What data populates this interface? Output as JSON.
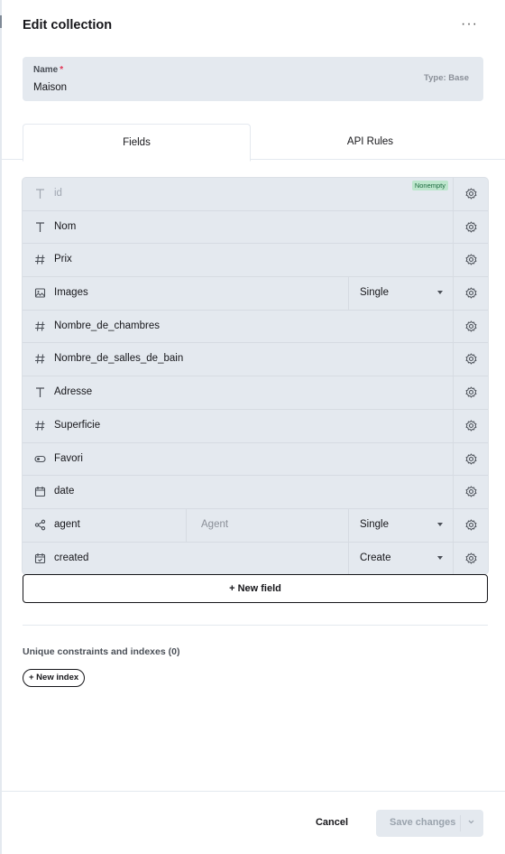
{
  "header": {
    "title": "Edit collection",
    "more": "···"
  },
  "name_field": {
    "label": "Name",
    "required": "*",
    "value": "Maison",
    "type": "Type: Base"
  },
  "tabs": [
    {
      "label": "Fields"
    },
    {
      "label": "API Rules"
    }
  ],
  "fields": [
    {
      "name": "id",
      "icon": "text-icon",
      "badge": "Nonempty"
    },
    {
      "name": "Nom",
      "icon": "text-icon"
    },
    {
      "name": "Prix",
      "icon": "number-icon"
    },
    {
      "name": "Images",
      "icon": "image-icon",
      "option": "Single"
    },
    {
      "name": "Nombre_de_chambres",
      "icon": "number-icon"
    },
    {
      "name": "Nombre_de_salles_de_bain",
      "icon": "number-icon"
    },
    {
      "name": "Adresse",
      "icon": "text-icon"
    },
    {
      "name": "Superficie",
      "icon": "number-icon"
    },
    {
      "name": "Favori",
      "icon": "toggle-icon"
    },
    {
      "name": "date",
      "icon": "calendar-icon"
    },
    {
      "name": "agent",
      "icon": "relation-icon",
      "collection": "Agent",
      "option": "Single"
    },
    {
      "name": "created",
      "icon": "calendar-check-icon",
      "option": "Create"
    }
  ],
  "new_field": "+  New field",
  "unique": {
    "title": "Unique constraints and indexes (0)",
    "new_index": "+ New index"
  },
  "footer": {
    "cancel": "Cancel",
    "save": "Save changes"
  }
}
